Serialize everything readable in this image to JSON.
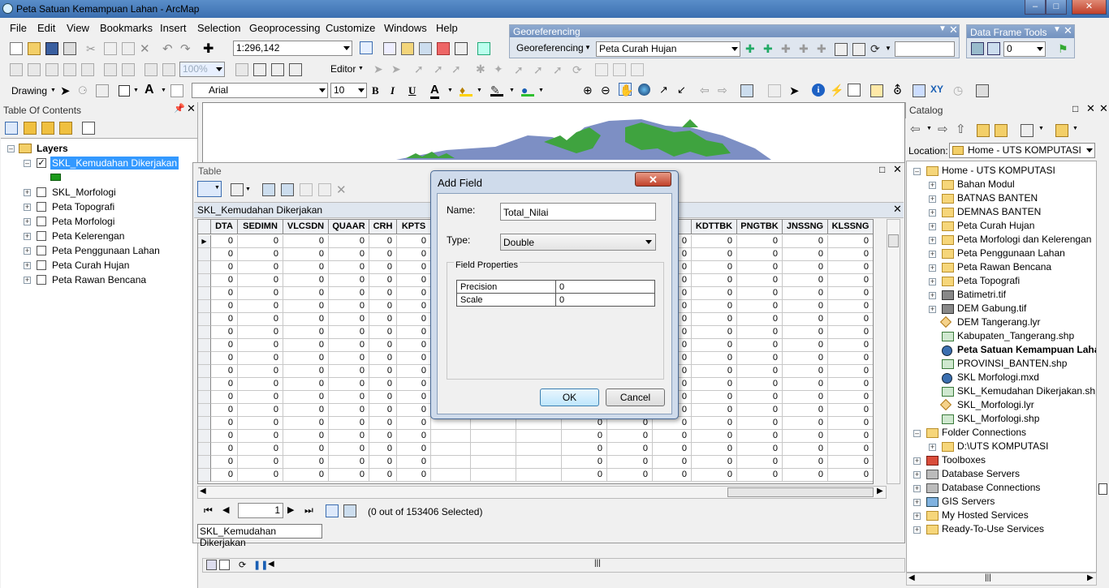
{
  "window": {
    "title": "Peta Satuan Kemampuan Lahan - ArcMap"
  },
  "menu": [
    "File",
    "Edit",
    "View",
    "Bookmarks",
    "Insert",
    "Selection",
    "Geoprocessing",
    "Customize",
    "Windows",
    "Help"
  ],
  "standard": {
    "scale": "1:296,142"
  },
  "georef": {
    "title": "Georeferencing",
    "menu_label": "Georeferencing",
    "layer": "Peta Curah Hujan"
  },
  "dataframe": {
    "title": "Data Frame Tools",
    "value": "0"
  },
  "editor": {
    "label": "Editor",
    "zoom": "100%"
  },
  "drawing": {
    "label": "Drawing",
    "font": "Arial",
    "size": "10",
    "bold": "B",
    "italic": "I",
    "underline": "U",
    "text_color_glyph": "A"
  },
  "toc": {
    "title": "Table Of Contents",
    "root": "Layers",
    "layers": [
      {
        "name": "SKL_Kemudahan Dikerjakan",
        "checked": true,
        "selected": true
      },
      {
        "name": "SKL_Morfologi",
        "checked": false
      },
      {
        "name": "Peta Topografi",
        "checked": false
      },
      {
        "name": "Peta Morfologi",
        "checked": false
      },
      {
        "name": "Peta Kelerengan",
        "checked": false
      },
      {
        "name": "Peta Penggunaan Lahan",
        "checked": false
      },
      {
        "name": "Peta Curah Hujan",
        "checked": false
      },
      {
        "name": "Peta Rawan Bencana",
        "checked": false
      }
    ]
  },
  "table": {
    "window_title": "Table",
    "name": "SKL_Kemudahan Dikerjakan",
    "columns": [
      "DTA",
      "SEDIMN",
      "VLCSDN",
      "QUAAR",
      "CRH",
      "KPTS",
      "",
      "",
      "",
      "",
      "",
      "R",
      "KDTTBK",
      "PNGTBK",
      "JNSSNG",
      "KLSSNG"
    ],
    "cell_value": "0",
    "record": "1",
    "selection": "(0 out of 153406 Selected)",
    "tab": "SKL_Kemudahan Dikerjakan"
  },
  "dialog": {
    "title": "Add Field",
    "name_label": "Name:",
    "name_value": "Total_Nilai",
    "type_label": "Type:",
    "type_value": "Double",
    "props_label": "Field Properties",
    "props": [
      {
        "k": "Precision",
        "v": "0"
      },
      {
        "k": "Scale",
        "v": "0"
      }
    ],
    "ok": "OK",
    "cancel": "Cancel"
  },
  "catalog": {
    "title": "Catalog",
    "location_label": "Location:",
    "location": "Home - UTS KOMPUTASI",
    "items": [
      {
        "label": "Home - UTS KOMPUTASI",
        "level": 0,
        "icon": "home-folder",
        "exp": "-"
      },
      {
        "label": "Bahan Modul",
        "level": 1,
        "icon": "folder",
        "exp": "+"
      },
      {
        "label": "BATNAS BANTEN",
        "level": 1,
        "icon": "folder",
        "exp": "+"
      },
      {
        "label": "DEMNAS BANTEN",
        "level": 1,
        "icon": "folder",
        "exp": "+"
      },
      {
        "label": "Peta Curah Hujan",
        "level": 1,
        "icon": "folder",
        "exp": "+"
      },
      {
        "label": "Peta Morfologi dan Kelerengan",
        "level": 1,
        "icon": "folder",
        "exp": "+"
      },
      {
        "label": "Peta Penggunaan Lahan",
        "level": 1,
        "icon": "folder",
        "exp": "+"
      },
      {
        "label": "Peta Rawan Bencana",
        "level": 1,
        "icon": "folder",
        "exp": "+"
      },
      {
        "label": "Peta Topografi",
        "level": 1,
        "icon": "folder",
        "exp": "+"
      },
      {
        "label": "Batimetri.tif",
        "level": 1,
        "icon": "raster",
        "exp": "+"
      },
      {
        "label": "DEM Gabung.tif",
        "level": 1,
        "icon": "raster",
        "exp": "+"
      },
      {
        "label": "DEM Tangerang.lyr",
        "level": 1,
        "icon": "layer-file",
        "exp": ""
      },
      {
        "label": "Kabupaten_Tangerang.shp",
        "level": 1,
        "icon": "shapefile",
        "exp": ""
      },
      {
        "label": "Peta Satuan Kemampuan Lahan.mxd",
        "level": 1,
        "icon": "map-document",
        "exp": "",
        "bold": true
      },
      {
        "label": "PROVINSI_BANTEN.shp",
        "level": 1,
        "icon": "shapefile",
        "exp": ""
      },
      {
        "label": "SKL Morfologi.mxd",
        "level": 1,
        "icon": "map-document",
        "exp": ""
      },
      {
        "label": "SKL_Kemudahan Dikerjakan.shp",
        "level": 1,
        "icon": "shapefile",
        "exp": ""
      },
      {
        "label": "SKL_Morfologi.lyr",
        "level": 1,
        "icon": "layer-file",
        "exp": ""
      },
      {
        "label": "SKL_Morfologi.shp",
        "level": 1,
        "icon": "shapefile",
        "exp": ""
      },
      {
        "label": "Folder Connections",
        "level": 0,
        "icon": "folder",
        "exp": "-"
      },
      {
        "label": "D:\\UTS KOMPUTASI",
        "level": 1,
        "icon": "folder",
        "exp": "+"
      },
      {
        "label": "Toolboxes",
        "level": 0,
        "icon": "toolbox",
        "exp": "+"
      },
      {
        "label": "Database Servers",
        "level": 0,
        "icon": "db-server",
        "exp": "+"
      },
      {
        "label": "Database Connections",
        "level": 0,
        "icon": "db-connection",
        "exp": "+"
      },
      {
        "label": "GIS Servers",
        "level": 0,
        "icon": "gis-server",
        "exp": "+"
      },
      {
        "label": "My Hosted Services",
        "level": 0,
        "icon": "hosted",
        "exp": "+"
      },
      {
        "label": "Ready-To-Use Services",
        "level": 0,
        "icon": "ready",
        "exp": "+"
      }
    ]
  },
  "colors": {
    "titlebar": "#3b6fb0",
    "selection": "#3399ff",
    "map_green": "#3fa33f",
    "map_blue": "#7d8fc4"
  }
}
